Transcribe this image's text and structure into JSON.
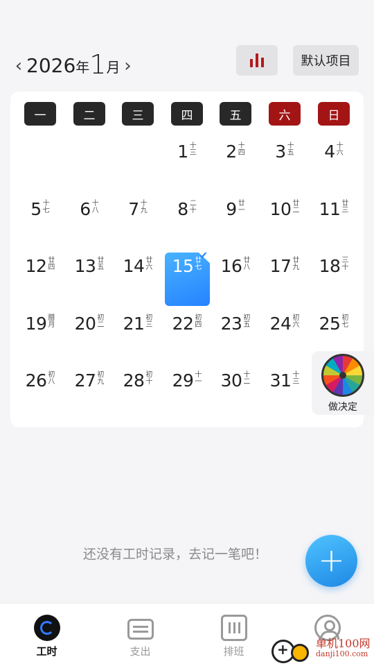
{
  "header": {
    "prev_icon": "chevron-left-icon",
    "year": "2026",
    "year_unit": "年",
    "month": "1",
    "month_unit": "月",
    "next_icon": "chevron-right-icon",
    "stats_icon": "bar-chart-icon",
    "default_project_label": "默认项目"
  },
  "colors": {
    "accent": "#2583ff",
    "weekend": "#a31515",
    "weekday": "#282828"
  },
  "weekdays": [
    "一",
    "二",
    "三",
    "四",
    "五",
    "六",
    "日"
  ],
  "days": [
    {
      "n": "1",
      "lunar": "十三",
      "col": 3,
      "row": 0
    },
    {
      "n": "2",
      "lunar": "十四",
      "col": 4,
      "row": 0
    },
    {
      "n": "3",
      "lunar": "十五",
      "col": 5,
      "row": 0
    },
    {
      "n": "4",
      "lunar": "十六",
      "col": 6,
      "row": 0
    },
    {
      "n": "5",
      "lunar": "十七",
      "col": 0,
      "row": 1
    },
    {
      "n": "6",
      "lunar": "十八",
      "col": 1,
      "row": 1
    },
    {
      "n": "7",
      "lunar": "十九",
      "col": 2,
      "row": 1
    },
    {
      "n": "8",
      "lunar": "二十",
      "col": 3,
      "row": 1
    },
    {
      "n": "9",
      "lunar": "廿一",
      "col": 4,
      "row": 1
    },
    {
      "n": "10",
      "lunar": "廿二",
      "col": 5,
      "row": 1
    },
    {
      "n": "11",
      "lunar": "廿三",
      "col": 6,
      "row": 1
    },
    {
      "n": "12",
      "lunar": "廿四",
      "col": 0,
      "row": 2
    },
    {
      "n": "13",
      "lunar": "廿五",
      "col": 1,
      "row": 2
    },
    {
      "n": "14",
      "lunar": "廿六",
      "col": 2,
      "row": 2
    },
    {
      "n": "15",
      "lunar": "廿七",
      "col": 3,
      "row": 2,
      "today": true
    },
    {
      "n": "16",
      "lunar": "廿八",
      "col": 4,
      "row": 2
    },
    {
      "n": "17",
      "lunar": "廿九",
      "col": 5,
      "row": 2
    },
    {
      "n": "18",
      "lunar": "三十",
      "col": 6,
      "row": 2
    },
    {
      "n": "19",
      "lunar": "腊月",
      "col": 0,
      "row": 3
    },
    {
      "n": "20",
      "lunar": "初二",
      "col": 1,
      "row": 3
    },
    {
      "n": "21",
      "lunar": "初三",
      "col": 2,
      "row": 3
    },
    {
      "n": "22",
      "lunar": "初四",
      "col": 3,
      "row": 3
    },
    {
      "n": "23",
      "lunar": "初五",
      "col": 4,
      "row": 3
    },
    {
      "n": "24",
      "lunar": "初六",
      "col": 5,
      "row": 3
    },
    {
      "n": "25",
      "lunar": "初七",
      "col": 6,
      "row": 3
    },
    {
      "n": "26",
      "lunar": "初八",
      "col": 0,
      "row": 4
    },
    {
      "n": "27",
      "lunar": "初九",
      "col": 1,
      "row": 4
    },
    {
      "n": "28",
      "lunar": "初十",
      "col": 2,
      "row": 4
    },
    {
      "n": "29",
      "lunar": "十一",
      "col": 3,
      "row": 4
    },
    {
      "n": "30",
      "lunar": "十二",
      "col": 4,
      "row": 4
    },
    {
      "n": "31",
      "lunar": "十三",
      "col": 5,
      "row": 4
    }
  ],
  "decide": {
    "icon": "wheel-icon",
    "label": "做决定"
  },
  "empty_hint": "还没有工时记录，去记一笔吧！",
  "fab": {
    "icon": "plus-icon",
    "label": "+"
  },
  "tabs": [
    {
      "label": "工时",
      "icon": "worktime-icon",
      "active": true
    },
    {
      "label": "支出",
      "icon": "wallet-icon",
      "active": false
    },
    {
      "label": "排班",
      "icon": "schedule-icon",
      "active": false
    },
    {
      "label": "",
      "icon": "profile-icon",
      "active": false
    }
  ],
  "watermark": {
    "name": "单机100网",
    "url": "danji100.com"
  }
}
